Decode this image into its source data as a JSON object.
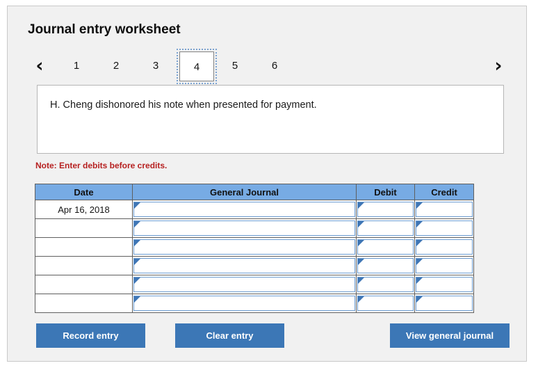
{
  "panel": {
    "title": "Journal entry worksheet"
  },
  "pager": {
    "prev_icon": "chevron-left-icon",
    "next_icon": "chevron-right-icon",
    "prev_glyph": "‹",
    "next_glyph": "›",
    "tabs": [
      {
        "label": "1",
        "selected": false
      },
      {
        "label": "2",
        "selected": false
      },
      {
        "label": "3",
        "selected": false
      },
      {
        "label": "4",
        "selected": true
      },
      {
        "label": "5",
        "selected": false
      },
      {
        "label": "6",
        "selected": false
      }
    ]
  },
  "description": {
    "text": "H. Cheng dishonored his note when presented for payment."
  },
  "note": {
    "text": "Note: Enter debits before credits."
  },
  "table": {
    "headers": {
      "date": "Date",
      "general_journal": "General Journal",
      "debit": "Debit",
      "credit": "Credit"
    },
    "rows": [
      {
        "date": "Apr 16, 2018",
        "general_journal": "",
        "debit": "",
        "credit": ""
      },
      {
        "date": "",
        "general_journal": "",
        "debit": "",
        "credit": ""
      },
      {
        "date": "",
        "general_journal": "",
        "debit": "",
        "credit": ""
      },
      {
        "date": "",
        "general_journal": "",
        "debit": "",
        "credit": ""
      },
      {
        "date": "",
        "general_journal": "",
        "debit": "",
        "credit": ""
      },
      {
        "date": "",
        "general_journal": "",
        "debit": "",
        "credit": ""
      }
    ]
  },
  "buttons": {
    "record": "Record entry",
    "clear": "Clear entry",
    "view": "View general journal"
  },
  "colors": {
    "panel_bg": "#f1f1f1",
    "header_blue": "#77abe4",
    "button_blue": "#3c77b6",
    "note_red": "#b62020",
    "input_border_blue": "#6a9bd1",
    "input_flag_blue": "#3f76b5"
  }
}
